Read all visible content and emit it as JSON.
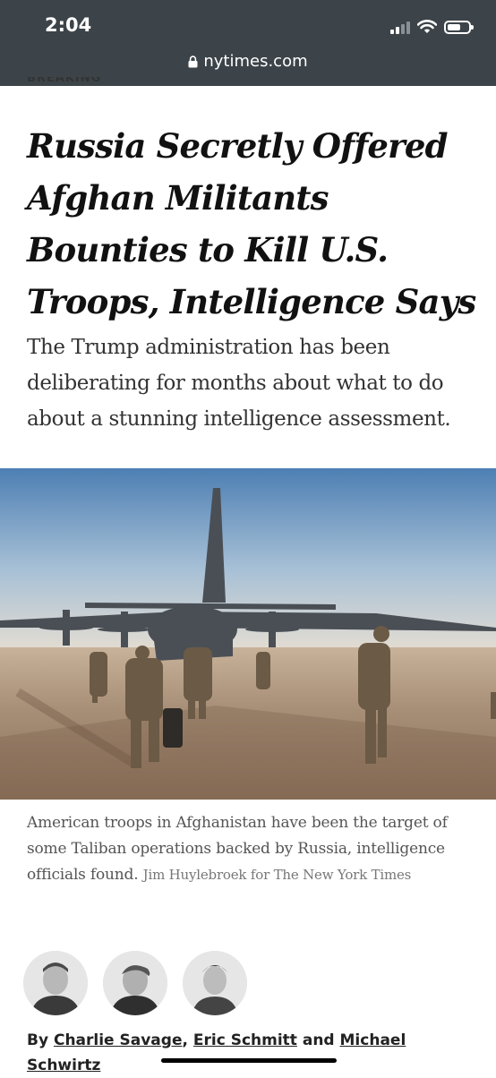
{
  "status_bar": {
    "time": "2:04"
  },
  "browser": {
    "url": "nytimes.com"
  },
  "article": {
    "kicker": "BREAKING",
    "headline": "Russia Secretly Offered Afghan Militants Bounties to Kill U.S. Troops, Intelligence Says",
    "summary": "The Trump administration has been deliberating for months about what to do about a stunning intelligence assessment.",
    "caption": "American troops in Afghanistan have been the target of some Taliban operations backed by Russia, intelligence officials found.",
    "credit": "Jim Huylebroek for The New York Times",
    "byline": {
      "prefix": "By",
      "authors": [
        "Charlie Savage",
        "Eric Schmitt",
        "Michael Schwirtz"
      ],
      "separator": ",",
      "and": "and"
    }
  },
  "icons": [
    "lock-icon",
    "signal-icon",
    "wifi-icon",
    "battery-icon"
  ]
}
